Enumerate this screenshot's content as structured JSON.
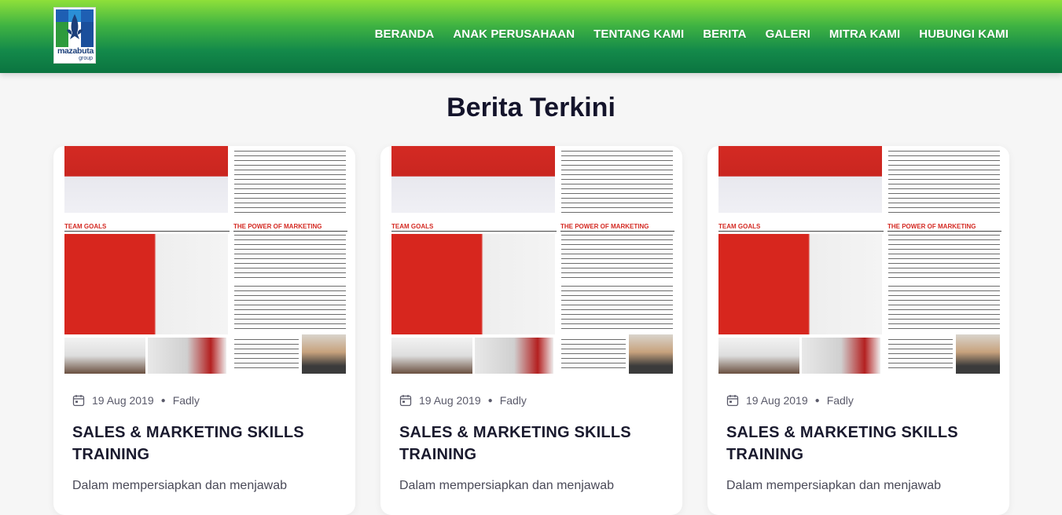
{
  "brand": {
    "logo_text": "mazabuta",
    "logo_sub": "group",
    "colors": {
      "header_top": "#8ee03a",
      "header_bottom": "#0b7440",
      "logo_blue": "#1b3f7a"
    }
  },
  "nav": {
    "items": [
      {
        "label": "BERANDA"
      },
      {
        "label": "ANAK PERUSAHAAN"
      },
      {
        "label": "TENTANG KAMI"
      },
      {
        "label": "BERITA"
      },
      {
        "label": "GALERI"
      },
      {
        "label": "MITRA KAMI"
      },
      {
        "label": "HUBUNGI KAMI"
      }
    ]
  },
  "section": {
    "title": "Berita Terkini"
  },
  "cards": [
    {
      "date": "19 Aug 2019",
      "author": "Fadly",
      "title": "SALES & MARKETING SKILLS TRAINING",
      "excerpt": "Dalam mempersiapkan dan menjawab",
      "image": {
        "team_goals": "TEAM GOALS",
        "power": "THE POWER OF MARKETING"
      }
    },
    {
      "date": "19 Aug 2019",
      "author": "Fadly",
      "title": "SALES & MARKETING SKILLS TRAINING",
      "excerpt": "Dalam mempersiapkan dan menjawab",
      "image": {
        "team_goals": "TEAM GOALS",
        "power": "THE POWER OF MARKETING"
      }
    },
    {
      "date": "19 Aug 2019",
      "author": "Fadly",
      "title": "SALES & MARKETING SKILLS TRAINING",
      "excerpt": "Dalam mempersiapkan dan menjawab",
      "image": {
        "team_goals": "TEAM GOALS",
        "power": "THE POWER OF MARKETING"
      }
    }
  ],
  "icons": {
    "date": "calendar-icon"
  }
}
